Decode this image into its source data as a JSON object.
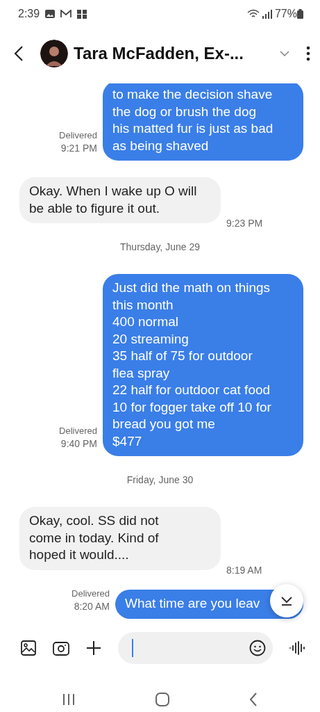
{
  "status_bar": {
    "time": "2:39",
    "battery": "77%"
  },
  "header": {
    "contact": "Tara McFadden, Ex-..."
  },
  "messages": [
    {
      "kind": "outgoing",
      "text": "to make the decision shave\nthe dog or brush the dog\nhis matted fur is just as bad\nas being shaved",
      "status": "Delivered",
      "time": "9:21 PM"
    },
    {
      "kind": "incoming",
      "text": "Okay. When I wake up O will\nbe able to figure it out.",
      "time": "9:23 PM"
    },
    {
      "kind": "date",
      "text": "Thursday, June 29"
    },
    {
      "kind": "outgoing",
      "text": "Just did the math on things\nthis month\n400 normal\n20 streaming\n35 half of 75 for outdoor\nflea spray\n22 half for outdoor cat food\n10 for fogger take off 10 for\nbread you got me\n$477",
      "status": "Delivered",
      "time": "9:40 PM"
    },
    {
      "kind": "date",
      "text": "Friday, June 30"
    },
    {
      "kind": "incoming",
      "text": "Okay, cool. SS did not\ncome in today. Kind of\nhoped it would....",
      "time": "8:19 AM"
    },
    {
      "kind": "outgoing",
      "text": "What time are you leav",
      "status": "Delivered",
      "time": "8:20 AM"
    }
  ]
}
